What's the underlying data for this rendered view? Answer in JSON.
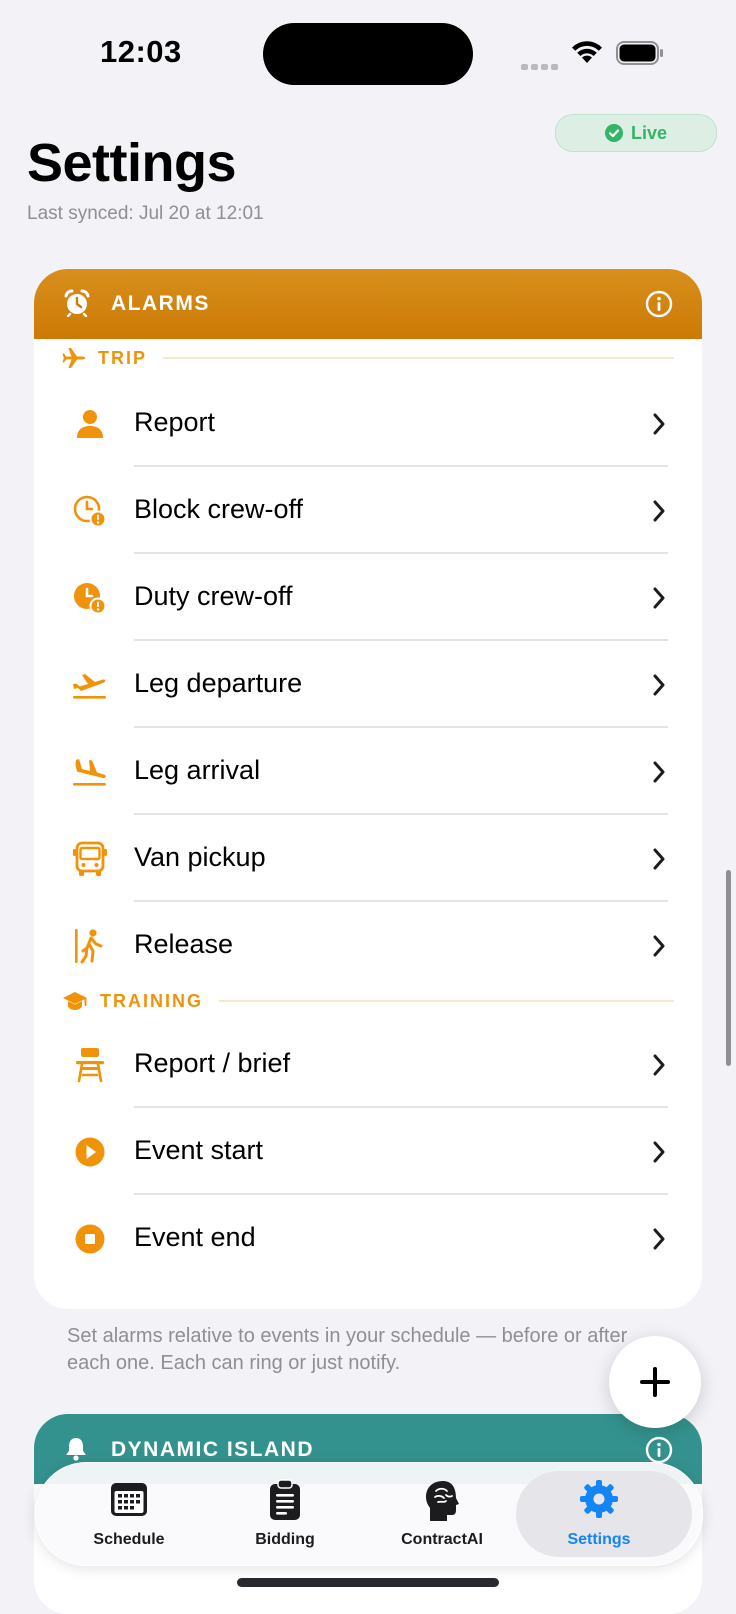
{
  "status_bar": {
    "time": "12:03"
  },
  "header": {
    "title": "Settings",
    "sync_text": "Last synced: Jul 20 at 12:01",
    "live_badge": "Live",
    "live_color": "#34b466"
  },
  "alarms_card": {
    "title": "ALARMS",
    "accent": "#f0930a",
    "icon": "alarm-clock-icon",
    "sections": [
      {
        "label": "TRIP",
        "icon": "airplane-icon",
        "items": [
          {
            "label": "Report",
            "icon": "person-icon"
          },
          {
            "label": "Block crew-off",
            "icon": "clock-alert-outline-icon"
          },
          {
            "label": "Duty crew-off",
            "icon": "clock-alert-filled-icon"
          },
          {
            "label": "Leg departure",
            "icon": "airplane-departure-icon"
          },
          {
            "label": "Leg arrival",
            "icon": "airplane-arrival-icon"
          },
          {
            "label": "Van pickup",
            "icon": "bus-icon"
          },
          {
            "label": "Release",
            "icon": "person-walking-exit-icon"
          }
        ]
      },
      {
        "label": "TRAINING",
        "icon": "graduation-cap-icon",
        "items": [
          {
            "label": "Report / brief",
            "icon": "desk-chair-icon"
          },
          {
            "label": "Event start",
            "icon": "play-circle-icon"
          },
          {
            "label": "Event end",
            "icon": "stop-circle-icon"
          }
        ]
      }
    ],
    "footnote": "Set alarms relative to events in your schedule — before or after each one. Each can ring or just notify."
  },
  "dynamic_island_card": {
    "title": "DYNAMIC ISLAND",
    "accent": "#34928e",
    "icon": "bell-icon"
  },
  "fab": {
    "icon": "plus-icon"
  },
  "tab_bar": {
    "tabs": [
      {
        "label": "Schedule",
        "icon": "calendar-icon",
        "active": false
      },
      {
        "label": "Bidding",
        "icon": "clipboard-icon",
        "active": false
      },
      {
        "label": "ContractAI",
        "icon": "brain-head-icon",
        "active": false
      },
      {
        "label": "Settings",
        "icon": "gear-icon",
        "active": true
      }
    ],
    "active_color": "#1485f5"
  }
}
